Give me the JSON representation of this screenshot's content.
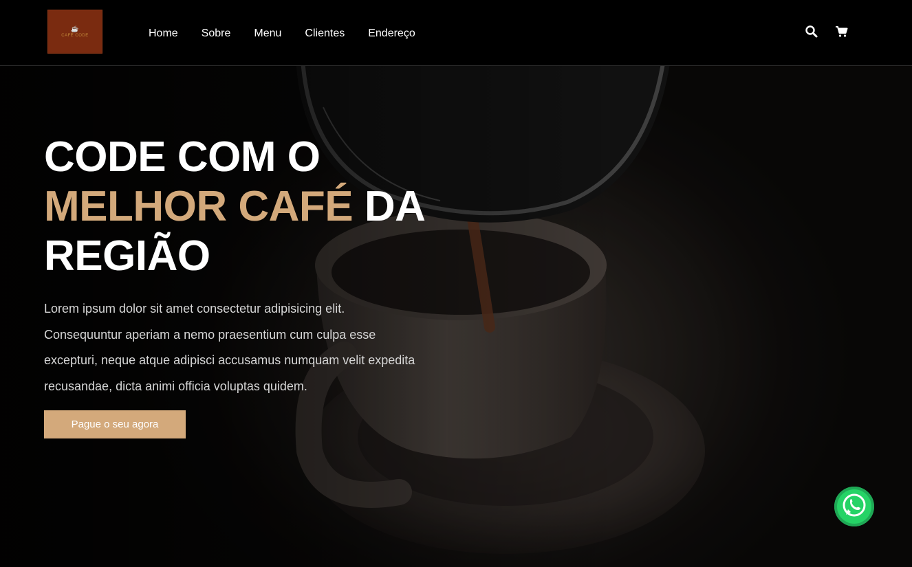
{
  "header": {
    "logo": {
      "icon": "cup-icon",
      "text": "CAFÉ CODE"
    },
    "nav": [
      {
        "label": "Home"
      },
      {
        "label": "Sobre"
      },
      {
        "label": "Menu"
      },
      {
        "label": "Clientes"
      },
      {
        "label": "Endereço"
      }
    ],
    "icons": [
      "search-icon",
      "cart-icon"
    ]
  },
  "hero": {
    "title_line1": "CODE COM O",
    "title_accent": "MELHOR CAFÉ",
    "title_after_accent": " DA",
    "title_line3": "REGIÃO",
    "text_lines": [
      "Lorem ipsum dolor sit amet consectetur adipisicing elit.",
      "Consequuntur aperiam a nemo praesentium cum culpa esse",
      "excepturi, neque atque adipisci accusamus numquam velit expedita",
      "recusandae, dicta animi officia voluptas quidem."
    ],
    "cta_label": "Pague o seu agora"
  },
  "floating": {
    "icon": "whatsapp-icon"
  },
  "colors": {
    "accent": "#d3a97b",
    "header_bg": "#000000",
    "logo_bg": "#7a2b10",
    "whatsapp": "#25d366"
  }
}
